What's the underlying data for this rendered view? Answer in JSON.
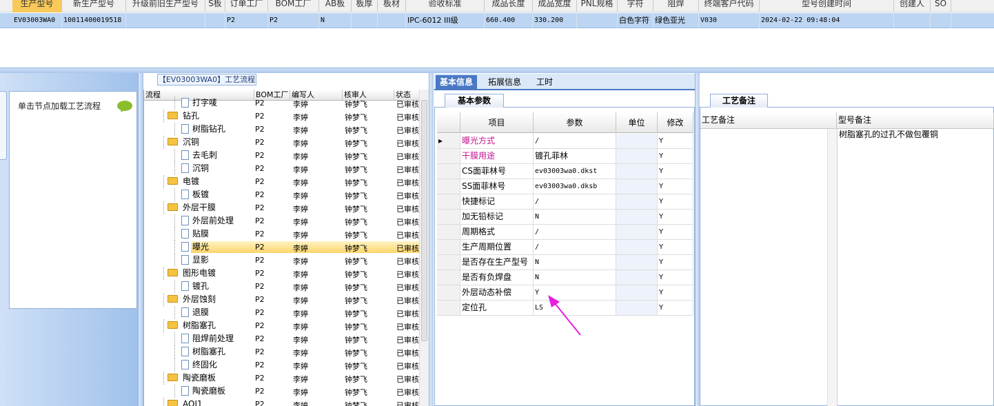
{
  "top_grid": {
    "headers": [
      "生产型号",
      "新生产型号",
      "升级前旧生产型号",
      "S板",
      "订单工厂",
      "BOM工厂",
      "AB板",
      "板厚",
      "板材",
      "验收标准",
      "成品长度",
      "成品宽度",
      "PNL规格",
      "字符",
      "阻焊",
      "终端客户代码",
      "型号创建时间",
      "创建人",
      "SO"
    ],
    "row": [
      "EV03003WA0",
      "10011400019518",
      "",
      "",
      "P2",
      "P2",
      "N",
      "",
      "",
      "IPC-6012 III级",
      "660.400",
      "330.200",
      "",
      "白色字符",
      "绿色亚光",
      "V030",
      "2024-02-22 09:48:04",
      "",
      ""
    ]
  },
  "left": {
    "hint": "单击节点加载工艺流程"
  },
  "tree": {
    "title": "【EV03003WA0】工艺流程",
    "headers": [
      "流程",
      "BOM工厂",
      "编写人",
      "核审人",
      "状态"
    ],
    "rows": [
      {
        "name": "打字唛",
        "type": "doc",
        "level": 2,
        "factory": "P2",
        "writer": "李婷",
        "reviewer": "钟梦飞",
        "status": "已审核"
      },
      {
        "name": "钻孔",
        "type": "folder",
        "level": 1,
        "factory": "P2",
        "writer": "李婷",
        "reviewer": "钟梦飞",
        "status": "已审核"
      },
      {
        "name": "树脂钻孔",
        "type": "doc",
        "level": 2,
        "factory": "P2",
        "writer": "李婷",
        "reviewer": "钟梦飞",
        "status": "已审核"
      },
      {
        "name": "沉铜",
        "type": "folder",
        "level": 1,
        "factory": "P2",
        "writer": "李婷",
        "reviewer": "钟梦飞",
        "status": "已审核"
      },
      {
        "name": "去毛刺",
        "type": "doc",
        "level": 2,
        "factory": "P2",
        "writer": "李婷",
        "reviewer": "钟梦飞",
        "status": "已审核"
      },
      {
        "name": "沉铜",
        "type": "doc",
        "level": 2,
        "factory": "P2",
        "writer": "李婷",
        "reviewer": "钟梦飞",
        "status": "已审核"
      },
      {
        "name": "电镀",
        "type": "folder",
        "level": 1,
        "factory": "P2",
        "writer": "李婷",
        "reviewer": "钟梦飞",
        "status": "已审核"
      },
      {
        "name": "板镀",
        "type": "doc",
        "level": 2,
        "factory": "P2",
        "writer": "李婷",
        "reviewer": "钟梦飞",
        "status": "已审核"
      },
      {
        "name": "外层干膜",
        "type": "folder",
        "level": 1,
        "factory": "P2",
        "writer": "李婷",
        "reviewer": "钟梦飞",
        "status": "已审核"
      },
      {
        "name": "外层前处理",
        "type": "doc",
        "level": 2,
        "factory": "P2",
        "writer": "李婷",
        "reviewer": "钟梦飞",
        "status": "已审核"
      },
      {
        "name": "贴膜",
        "type": "doc",
        "level": 2,
        "factory": "P2",
        "writer": "李婷",
        "reviewer": "钟梦飞",
        "status": "已审核"
      },
      {
        "name": "曝光",
        "type": "doc",
        "level": 2,
        "factory": "P2",
        "writer": "李婷",
        "reviewer": "钟梦飞",
        "status": "已审核",
        "selected": true
      },
      {
        "name": "显影",
        "type": "doc",
        "level": 2,
        "factory": "P2",
        "writer": "李婷",
        "reviewer": "钟梦飞",
        "status": "已审核"
      },
      {
        "name": "图形电镀",
        "type": "folder",
        "level": 1,
        "factory": "P2",
        "writer": "李婷",
        "reviewer": "钟梦飞",
        "status": "已审核"
      },
      {
        "name": "镀孔",
        "type": "doc",
        "level": 2,
        "factory": "P2",
        "writer": "李婷",
        "reviewer": "钟梦飞",
        "status": "已审核"
      },
      {
        "name": "外层蚀刻",
        "type": "folder",
        "level": 1,
        "factory": "P2",
        "writer": "李婷",
        "reviewer": "钟梦飞",
        "status": "已审核"
      },
      {
        "name": "退膜",
        "type": "doc",
        "level": 2,
        "factory": "P2",
        "writer": "李婷",
        "reviewer": "钟梦飞",
        "status": "已审核"
      },
      {
        "name": "树脂塞孔",
        "type": "folder",
        "level": 1,
        "factory": "P2",
        "writer": "李婷",
        "reviewer": "钟梦飞",
        "status": "已审核"
      },
      {
        "name": "阻焊前处理",
        "type": "doc",
        "level": 2,
        "factory": "P2",
        "writer": "李婷",
        "reviewer": "钟梦飞",
        "status": "已审核"
      },
      {
        "name": "树脂塞孔",
        "type": "doc",
        "level": 2,
        "factory": "P2",
        "writer": "李婷",
        "reviewer": "钟梦飞",
        "status": "已审核"
      },
      {
        "name": "终固化",
        "type": "doc",
        "level": 2,
        "factory": "P2",
        "writer": "李婷",
        "reviewer": "钟梦飞",
        "status": "已审核"
      },
      {
        "name": "陶瓷磨板",
        "type": "folder",
        "level": 1,
        "factory": "P2",
        "writer": "李婷",
        "reviewer": "钟梦飞",
        "status": "已审核"
      },
      {
        "name": "陶瓷磨板",
        "type": "doc",
        "level": 2,
        "factory": "P2",
        "writer": "李婷",
        "reviewer": "钟梦飞",
        "status": "已审核"
      },
      {
        "name": "AOI1",
        "type": "folder",
        "level": 1,
        "factory": "P2",
        "writer": "李婷",
        "reviewer": "钟梦飞",
        "status": "已审核"
      }
    ]
  },
  "mid": {
    "tabs": [
      "基本信息",
      "拓展信息",
      "工时"
    ],
    "subtab": "基本参数",
    "headers": [
      "项目",
      "参数",
      "单位",
      "修改"
    ],
    "rows": [
      {
        "item": "曝光方式",
        "param": "/",
        "unit": "",
        "mod": "Y",
        "pink": true,
        "current": true
      },
      {
        "item": "干膜用途",
        "param": "镀孔菲林",
        "unit": "",
        "mod": "Y",
        "pink": true
      },
      {
        "item": "CS面菲林号",
        "param": "ev03003wa0.dkst",
        "unit": "",
        "mod": "Y"
      },
      {
        "item": "SS面菲林号",
        "param": "ev03003wa0.dksb",
        "unit": "",
        "mod": "Y"
      },
      {
        "item": "快捷标记",
        "param": "/",
        "unit": "",
        "mod": "Y"
      },
      {
        "item": "加无铅标记",
        "param": "N",
        "unit": "",
        "mod": "Y"
      },
      {
        "item": "周期格式",
        "param": "/",
        "unit": "",
        "mod": "Y"
      },
      {
        "item": "生产周期位置",
        "param": "/",
        "unit": "",
        "mod": "Y"
      },
      {
        "item": "是否存在生产型号",
        "param": "N",
        "unit": "",
        "mod": "Y"
      },
      {
        "item": "是否有负焊盘",
        "param": "N",
        "unit": "",
        "mod": "Y"
      },
      {
        "item": "外层动态补偿",
        "param": "Y",
        "unit": "",
        "mod": "Y"
      },
      {
        "item": "定位孔",
        "param": "LS",
        "unit": "",
        "mod": "Y"
      }
    ]
  },
  "right": {
    "tab": "工艺备注",
    "headers": [
      "工艺备注",
      "型号备注"
    ],
    "model_note": "树脂塞孔的过孔不做包覆铜"
  },
  "colors": {
    "accent": "#4a78c5",
    "selected_row": "#bcd5f2",
    "highlight": "#fbd56b",
    "pink_text": "#c0168f",
    "arrow": "#e81ee0"
  }
}
